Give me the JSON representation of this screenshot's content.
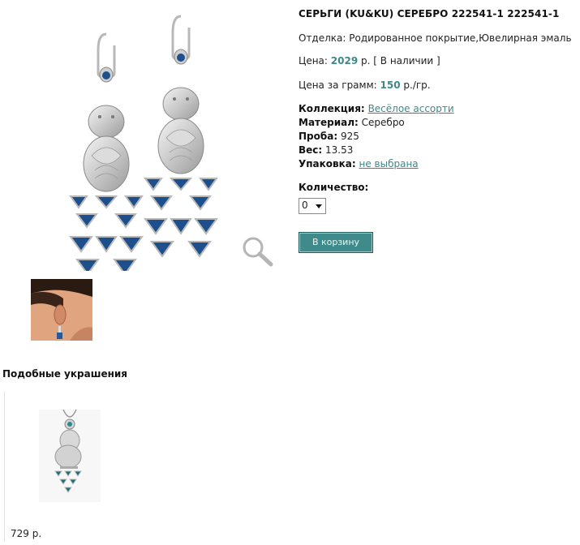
{
  "product": {
    "title": "СЕРЬГИ (KU&KU) СЕРЕБРО 222541-1 222541-1",
    "finish_label": "Отделка:",
    "finish_value": "Родированное покрытие,Ювелирная эмаль",
    "price_label": "Цена:",
    "price_value": "2029",
    "price_unit": "р.",
    "availability": "[ В наличии ]",
    "price_per_gram_label": "Цена за грамм:",
    "price_per_gram_value": "150",
    "price_per_gram_unit": "р./гр.",
    "collection_label": "Коллекция:",
    "collection_value": "Весёлое ассорти",
    "material_label": "Материал:",
    "material_value": "Серебро",
    "assay_label": "Проба:",
    "assay_value": "925",
    "weight_label": "Вес:",
    "weight_value": "13.53",
    "packaging_label": "Упаковка:",
    "packaging_value": "не выбрана",
    "quantity_label": "Количество:",
    "quantity_value": "0",
    "cart_button": "В корзину"
  },
  "related": {
    "title": "Подобные украшения",
    "items": [
      {
        "price": "729 р."
      }
    ]
  },
  "colors": {
    "accent": "#3f8888",
    "button": "#3f8a8b",
    "enamel": "#1d4f8c"
  },
  "icons": {
    "zoom": "magnifier-icon",
    "select_arrow": "chevron-down-icon"
  }
}
